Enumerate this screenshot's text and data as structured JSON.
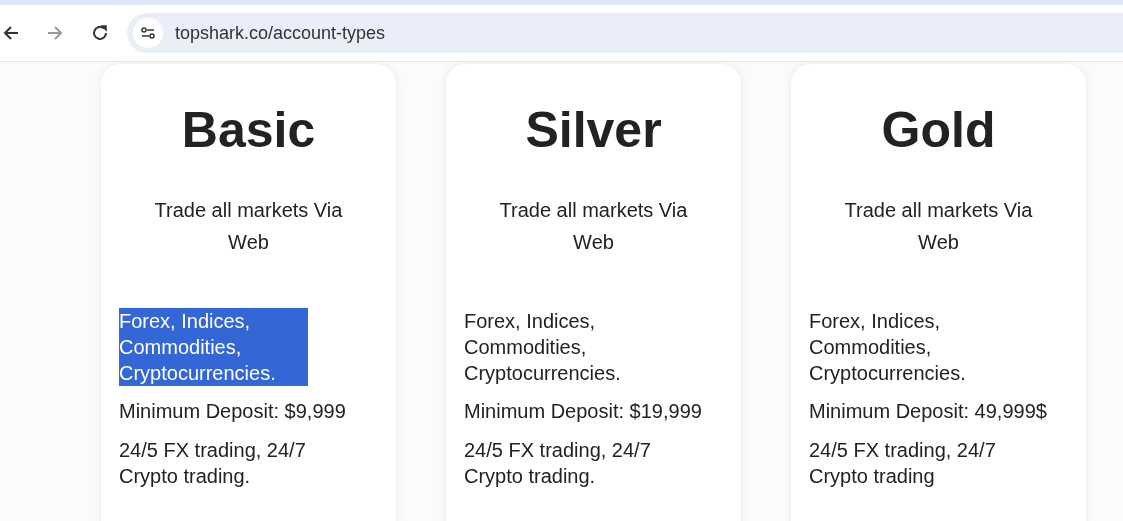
{
  "browser": {
    "url": "topshark.co/account-types"
  },
  "plans": [
    {
      "name": "Basic",
      "tagline": "Trade all markets Via Web",
      "features": "Forex, Indices, Commodities, Cryptocurrencies.",
      "features_selected": true,
      "deposit": "Minimum Deposit: $9,999",
      "hours": "24/5 FX trading, 24/7 Crypto trading."
    },
    {
      "name": "Silver",
      "tagline": "Trade all markets Via Web",
      "features": "Forex, Indices, Commodities, Cryptocurrencies.",
      "features_selected": false,
      "deposit": "Minimum Deposit: $19,999",
      "hours": "24/5 FX trading, 24/7 Crypto trading."
    },
    {
      "name": "Gold",
      "tagline": "Trade all markets Via Web",
      "features": "Forex, Indices, Commodities, Cryptocurrencies.",
      "features_selected": false,
      "deposit": "Minimum Deposit: 49,999$",
      "hours": "24/5 FX trading, 24/7 Crypto trading"
    }
  ]
}
